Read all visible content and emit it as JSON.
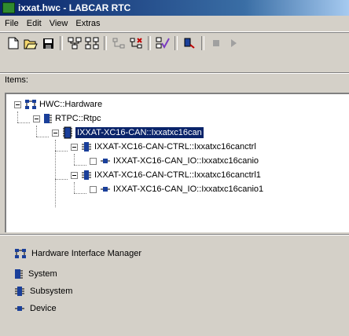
{
  "window": {
    "title": "ixxat.hwc - LABCAR RTC"
  },
  "menu": [
    "File",
    "Edit",
    "View",
    "Extras"
  ],
  "toolbar": {
    "buttons": [
      "new-file",
      "open-folder",
      "save",
      "tree-expand",
      "tree-collapse",
      "hardware-disabled",
      "hardware-add",
      "verify",
      "connect",
      "stop",
      "play"
    ]
  },
  "items_label": "Items:",
  "tree": {
    "nodes": [
      {
        "label": "HWC::Hardware",
        "type": "hardware-interface-manager"
      },
      {
        "label": "RTPC::Rtpc",
        "type": "system"
      },
      {
        "label": "IXXAT-XC16-CAN::Ixxatxc16can",
        "type": "board",
        "selected": true
      },
      {
        "label": "IXXAT-XC16-CAN-CTRL::Ixxatxc16canctrl",
        "type": "subsystem"
      },
      {
        "label": "IXXAT-XC16-CAN_IO::Ixxatxc16canio",
        "type": "device"
      },
      {
        "label": "IXXAT-XC16-CAN-CTRL::Ixxatxc16canctrl1",
        "type": "subsystem"
      },
      {
        "label": "IXXAT-XC16-CAN_IO::Ixxatxc16canio1",
        "type": "device"
      }
    ]
  },
  "legend": [
    {
      "label": "Hardware Interface Manager",
      "icon": "hardware-interface-manager-icon"
    },
    {
      "label": "System",
      "icon": "system-icon"
    },
    {
      "label": "Subsystem",
      "icon": "subsystem-icon"
    },
    {
      "label": "Device",
      "icon": "device-icon"
    }
  ]
}
